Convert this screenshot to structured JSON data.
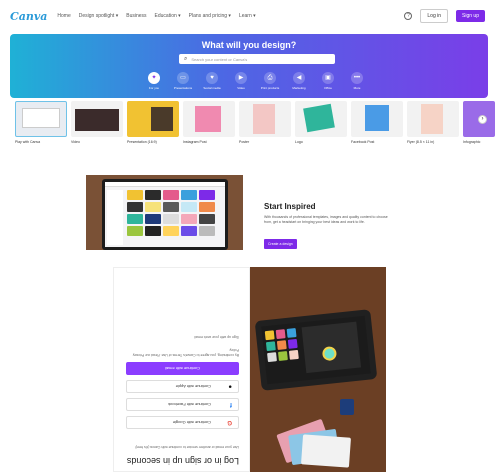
{
  "nav": {
    "logo": "Canva",
    "links": [
      "Home",
      "Design spotlight ▾",
      "Business",
      "Education ▾",
      "Plans and pricing ▾",
      "Learn ▾"
    ],
    "help_icon": "?",
    "login": "Log in",
    "signup": "Sign up"
  },
  "hero": {
    "title": "What will you design?",
    "search_placeholder": "Search your content or Canva's",
    "search_icon": "search-icon",
    "categories": [
      {
        "label": "For you",
        "icon": "✦",
        "active": true
      },
      {
        "label": "Presentations",
        "icon": "▭"
      },
      {
        "label": "Social media",
        "icon": "♥"
      },
      {
        "label": "Video",
        "icon": "▶"
      },
      {
        "label": "Print products",
        "icon": "⎙"
      },
      {
        "label": "Marketing",
        "icon": "◀"
      },
      {
        "label": "Office",
        "icon": "▣"
      },
      {
        "label": "More",
        "icon": "•••"
      }
    ]
  },
  "templates": [
    {
      "label": "Play with Canva",
      "color": "#e8ecf2"
    },
    {
      "label": "Video",
      "color": "#3b2b2b"
    },
    {
      "label": "Presentation (16:9)",
      "color": "#f1c232"
    },
    {
      "label": "Instagram Post",
      "color": "#f08ab0"
    },
    {
      "label": "Poster",
      "color": "#f3c7c5"
    },
    {
      "label": "Logo",
      "color": "#2fb59b"
    },
    {
      "label": "Facebook Post",
      "color": "#4a9be6"
    },
    {
      "label": "Flyer (8.5 × 11 in)",
      "color": "#f6d3c6"
    },
    {
      "label": "Infographic",
      "color": "#9a6be8"
    }
  ],
  "inspire": {
    "title": "Start Inspired",
    "text": "With thousands of professional templates, images and quality content to choose from, get a headstart on bringing your best ideas and work to life.",
    "button": "Create a design"
  },
  "login": {
    "title": "Log in or sign up in seconds",
    "subtitle": "Use your email or another service to continue with Canva (it's free)!",
    "google": "Continue with Google",
    "facebook": "Continue with Facebook",
    "apple": "Continue with Apple",
    "email": "Continue with email",
    "terms": "By continuing, you agree to Canva's Terms of Use. Read our Privacy Policy.",
    "work": "Sign up with your work email"
  },
  "colors": {
    "accent": "#7d2ae8",
    "hero_start": "#1fb1d6",
    "hero_end": "#7a3ee8"
  }
}
